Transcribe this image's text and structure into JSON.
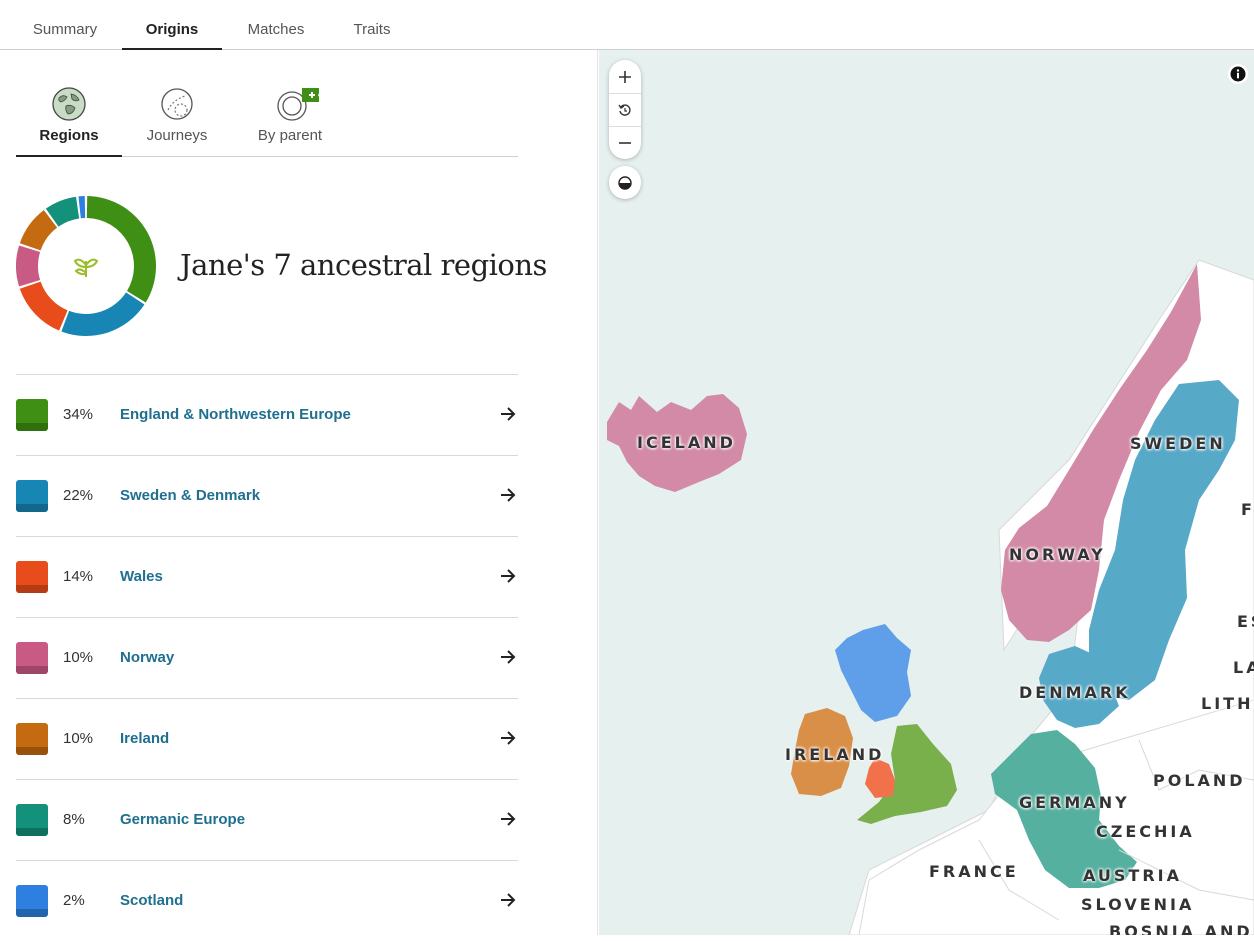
{
  "top_tabs": [
    {
      "label": "Summary"
    },
    {
      "label": "Origins",
      "active": true
    },
    {
      "label": "Matches"
    },
    {
      "label": "Traits"
    }
  ],
  "sub_tabs": [
    {
      "label": "Regions",
      "icon": "globe-icon",
      "active": true
    },
    {
      "label": "Journeys",
      "icon": "journeys-icon"
    },
    {
      "label": "By parent",
      "icon": "by-parent-icon",
      "badge": "+"
    }
  ],
  "headline": "Jane's 7 ancestral regions",
  "donut_center_icon": "leaf-icon",
  "regions": [
    {
      "name": "England & Northwestern Europe",
      "percent": "34%",
      "value": 34,
      "color": "#3e8f13"
    },
    {
      "name": "Sweden & Denmark",
      "percent": "22%",
      "value": 22,
      "color": "#1786b4"
    },
    {
      "name": "Wales",
      "percent": "14%",
      "value": 14,
      "color": "#e84c1b"
    },
    {
      "name": "Norway",
      "percent": "10%",
      "value": 10,
      "color": "#c95a84"
    },
    {
      "name": "Ireland",
      "percent": "10%",
      "value": 10,
      "color": "#c46a10"
    },
    {
      "name": "Germanic Europe",
      "percent": "8%",
      "value": 8,
      "color": "#13917a"
    },
    {
      "name": "Scotland",
      "percent": "2%",
      "value": 2,
      "color": "#2e80e0"
    }
  ],
  "map": {
    "controls": [
      {
        "name": "zoom-in-icon",
        "glyph": "+"
      },
      {
        "name": "reset-icon",
        "glyph": "↺"
      },
      {
        "name": "zoom-out-icon",
        "glyph": "−"
      }
    ],
    "contrast_icon": "contrast-icon",
    "info_icon": "info-icon",
    "labels": {
      "iceland": "ICELAND",
      "sweden": "SWEDEN",
      "norway": "NORWAY",
      "denmark": "DENMARK",
      "ireland": "IRELAND",
      "germany": "GERMANY",
      "poland": "POLAND",
      "czechia": "CZECHIA",
      "france": "FRANCE",
      "austria": "AUSTRIA",
      "slovenia": "SLOVENIA",
      "bosnia": "BOSNIA AND",
      "lithuania": "LITHU",
      "latvia": "LA",
      "estonia": "ES",
      "finland": "F"
    }
  }
}
